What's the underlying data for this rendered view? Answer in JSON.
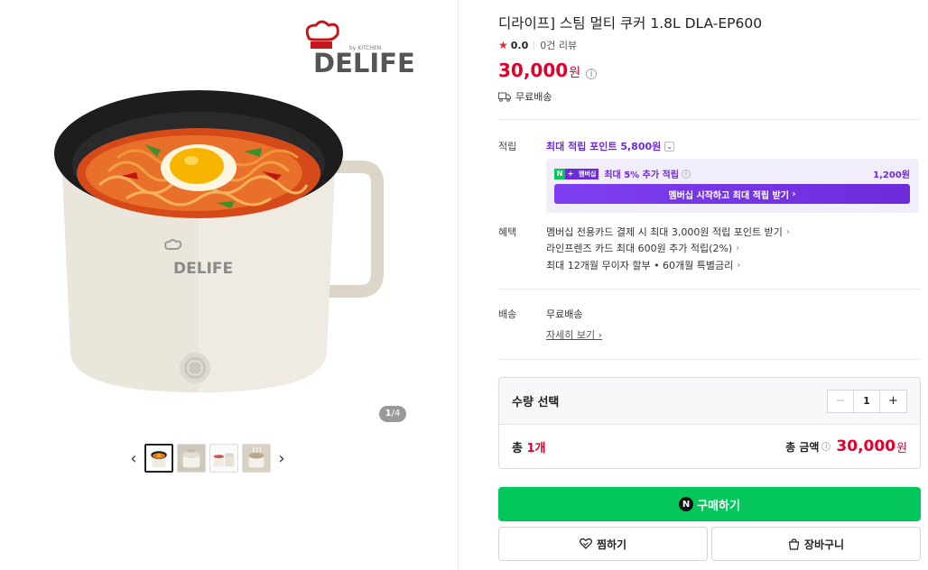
{
  "product": {
    "title": "디라이프] 스팀 멀티 쿠커 1.8L DLA-EP600",
    "rating_score": "0.0",
    "review_count": "0건 리뷰",
    "price": "30,000",
    "price_unit": "원",
    "shipping": "무료배송"
  },
  "gallery": {
    "brand_logo": "DELIFE",
    "brand_sub": "by KITCHEN",
    "current_page": "1",
    "total_pages": "/4",
    "thumbnails": [
      "ramen-cooker",
      "white-cooker",
      "cooker-set",
      "cooker-steam"
    ]
  },
  "points": {
    "label": "적립",
    "max_points": "최대 적립 포인트 5,800원",
    "membership_badge": "멤버십",
    "membership_text": "최대 5% 추가 적립",
    "membership_amount": "1,200원",
    "membership_cta": "멤버십 시작하고 최대 적립 받기"
  },
  "benefits": {
    "label": "혜택",
    "items": [
      "멤버십 전용카드 결제 시 최대 3,000원 적립 포인트 받기",
      "라인프렌즈 카드 최대 600원 추가 적립(2%)",
      "최대 12개월 무이자 할부 • 60개월 특별금리"
    ]
  },
  "delivery": {
    "label": "배송",
    "value": "무료배송",
    "detail_link": "자세히 보기"
  },
  "quantity": {
    "label": "수량 선택",
    "value": "1",
    "total_prefix": "총 ",
    "total_count": "1개",
    "total_amount_label": "총 금액",
    "total_amount": "30,000",
    "total_unit": "원"
  },
  "actions": {
    "buy": "구매하기",
    "wishlist": "찜하기",
    "cart": "장바구니"
  },
  "colors": {
    "price_red": "#e1002a",
    "naver_green": "#03c75a",
    "membership_purple": "#6d2bdb"
  }
}
